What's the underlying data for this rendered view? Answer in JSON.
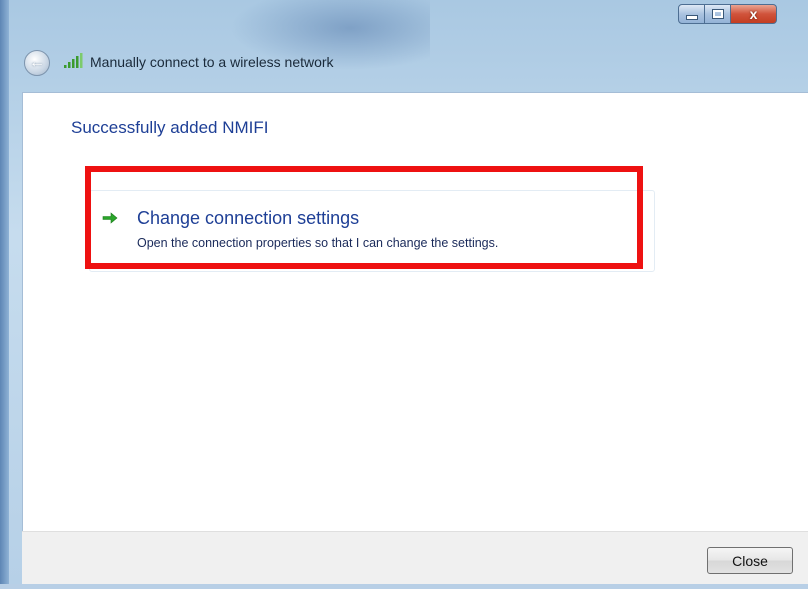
{
  "window": {
    "title": "Manually connect to a wireless network",
    "caption_buttons": {
      "minimize_icon": "minimize-icon",
      "maximize_icon": "maximize-icon",
      "close_icon": "close-icon",
      "close_glyph": "x"
    }
  },
  "nav": {
    "back_icon": "back-arrow-icon",
    "back_glyph": "←",
    "network_icon": "wireless-signal-icon"
  },
  "main": {
    "heading": "Successfully added NMIFI",
    "options": [
      {
        "icon": "green-arrow-icon",
        "title": "Change connection settings",
        "description": "Open the connection properties so that I can change the settings."
      }
    ],
    "highlight_color": "#ee1111"
  },
  "footer": {
    "close_label": "Close"
  },
  "colors": {
    "heading": "#1e3f96",
    "arrow_green": "#2aa52a",
    "frame": "#b6d0e7"
  }
}
